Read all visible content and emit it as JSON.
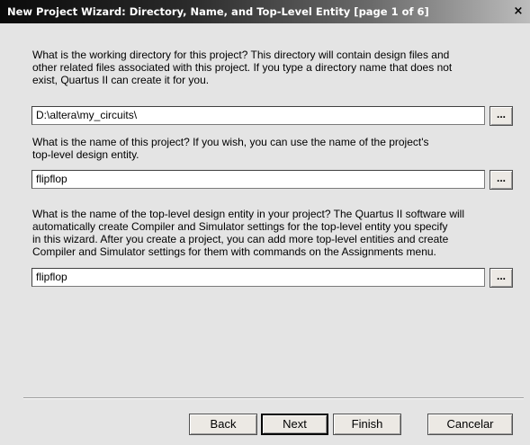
{
  "window": {
    "title": "New Project Wizard: Directory, Name, and Top-Level Entity [page 1 of 6]",
    "close_glyph": "×"
  },
  "sections": {
    "directory": {
      "prompt": "What is the working directory for this project?  This directory will contain design files and\nother related files associated with this project.  If you type a directory name that does not\nexist, Quartus II can create it for you.",
      "value": "D:\\altera\\my_circuits\\",
      "browse_label": "..."
    },
    "project_name": {
      "prompt": "What is the name of this project?  If you wish, you can use the name of the project's\ntop-level design entity.",
      "value": "flipflop",
      "browse_label": "..."
    },
    "top_level": {
      "prompt": "What is the name of the top-level design entity in your project?  The Quartus II software will\nautomatically create Compiler and Simulator settings for the top-level entity you specify\nin this wizard.  After you create a project, you can add more top-level entities and create\nCompiler and Simulator settings for them with commands on the Assignments menu.",
      "value": "flipflop",
      "browse_label": "..."
    }
  },
  "footer": {
    "back_label": "Back",
    "next_label": "Next",
    "finish_label": "Finish",
    "cancel_label": "Cancelar"
  }
}
